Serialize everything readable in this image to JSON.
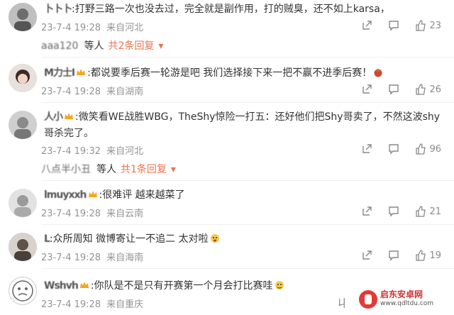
{
  "comments": [
    {
      "username": "卜卜卜",
      "text": ":打野三路一次也没去过，完全就是副作用，打的贼臭，还不如上karsa，",
      "time": "23-7-4 19:28",
      "location": "来自河北",
      "likes": "23",
      "reply": {
        "name": "aaa120",
        "suffix": "等人",
        "more": "共2条回复"
      }
    },
    {
      "username": "M力士I",
      "text": ":都说要季后赛一轮游是吧 我们选择接下来一把不赢不进季后赛！",
      "time": "23-7-4 19:28",
      "location": "来自湖南",
      "likes": "26"
    },
    {
      "username": "人小",
      "text": ":微笑看WE战胜WBG，TheShy惊险一打五：还好他们把Shy哥卖了，不然这波shy哥杀完了。",
      "time": "23-7-4 19:32",
      "location": "来自河北",
      "likes": "96",
      "reply": {
        "name": "八点半小丑",
        "suffix": "等人",
        "more": "共1条回复"
      }
    },
    {
      "username": "lmuyxxh",
      "text": ":很难评 越来越菜了",
      "time": "23-7-4 19:28",
      "location": "来自云南",
      "likes": "21"
    },
    {
      "username": "L",
      "text": ":众所周知 微博寄让一不追二 太对啦",
      "time": "23-7-4 19:28",
      "location": "来自海南",
      "likes": "19"
    },
    {
      "username": "Wshvh",
      "text": ":你队是不是只有开赛第一个月会打比赛哇",
      "time": "23-7-4 19:28",
      "location": "来自重庆",
      "likes": ""
    }
  ],
  "watermark": {
    "main": "启东安卓网",
    "sub": "www.qdltdu.com",
    "partial_icon_text": "ㄐ"
  },
  "colors": {
    "accent": "#eb7350",
    "meta": "#939393"
  }
}
